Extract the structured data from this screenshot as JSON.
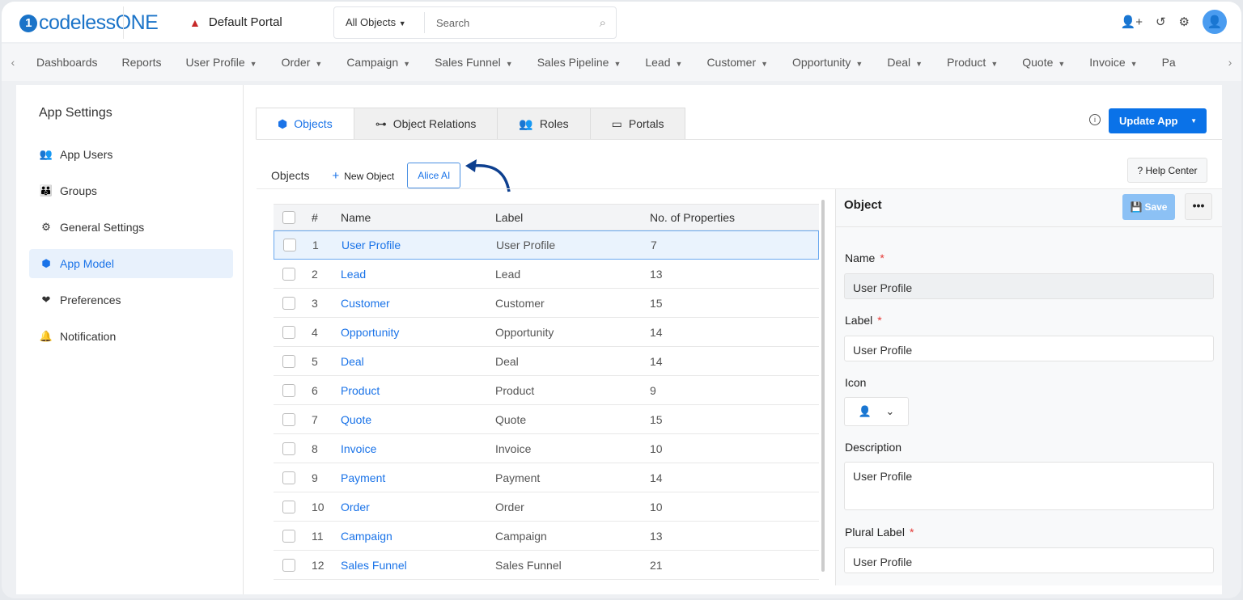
{
  "header": {
    "logo": "codelessONE",
    "portal": "Default Portal",
    "search_scope": "All Objects",
    "search_placeholder": "Search"
  },
  "nav": [
    "Dashboards",
    "Reports",
    "User Profile",
    "Order",
    "Campaign",
    "Sales Funnel",
    "Sales Pipeline",
    "Lead",
    "Customer",
    "Opportunity",
    "Deal",
    "Product",
    "Quote",
    "Invoice",
    "Pa"
  ],
  "nav_dropdown": [
    false,
    false,
    true,
    true,
    true,
    true,
    true,
    true,
    true,
    true,
    true,
    true,
    true,
    true,
    false
  ],
  "sidebar": {
    "title": "App Settings",
    "items": [
      {
        "label": "App Users",
        "icon": "users-icon"
      },
      {
        "label": "Groups",
        "icon": "groups-icon"
      },
      {
        "label": "General Settings",
        "icon": "gear-icon"
      },
      {
        "label": "App Model",
        "icon": "cube-icon",
        "active": true
      },
      {
        "label": "Preferences",
        "icon": "hand-heart-icon"
      },
      {
        "label": "Notification",
        "icon": "bell-icon"
      }
    ]
  },
  "tabs": [
    {
      "label": "Objects",
      "active": true
    },
    {
      "label": "Object Relations"
    },
    {
      "label": "Roles"
    },
    {
      "label": "Portals"
    }
  ],
  "toolbar": {
    "update": "Update App",
    "objects": "Objects",
    "new_object": "New Object",
    "alice": "Alice AI",
    "help": "? Help Center"
  },
  "table": {
    "headers": [
      "#",
      "Name",
      "Label",
      "No. of Properties"
    ],
    "rows": [
      [
        "1",
        "User Profile",
        "User Profile",
        "7"
      ],
      [
        "2",
        "Lead",
        "Lead",
        "13"
      ],
      [
        "3",
        "Customer",
        "Customer",
        "15"
      ],
      [
        "4",
        "Opportunity",
        "Opportunity",
        "14"
      ],
      [
        "5",
        "Deal",
        "Deal",
        "14"
      ],
      [
        "6",
        "Product",
        "Product",
        "9"
      ],
      [
        "7",
        "Quote",
        "Quote",
        "15"
      ],
      [
        "8",
        "Invoice",
        "Invoice",
        "10"
      ],
      [
        "9",
        "Payment",
        "Payment",
        "14"
      ],
      [
        "10",
        "Order",
        "Order",
        "10"
      ],
      [
        "11",
        "Campaign",
        "Campaign",
        "13"
      ],
      [
        "12",
        "Sales Funnel",
        "Sales Funnel",
        "21"
      ]
    ]
  },
  "detail": {
    "title": "Object",
    "save": "Save",
    "more": "•••",
    "name_label": "Name",
    "name": "User Profile",
    "label_label": "Label",
    "label": "User Profile",
    "icon_label": "Icon",
    "description_label": "Description",
    "description": "User Profile",
    "plural_label": "Plural Label",
    "plural": "User Profile"
  },
  "colors": {
    "accent": "#0a72e8",
    "selected_row": "#eaf3fd"
  }
}
